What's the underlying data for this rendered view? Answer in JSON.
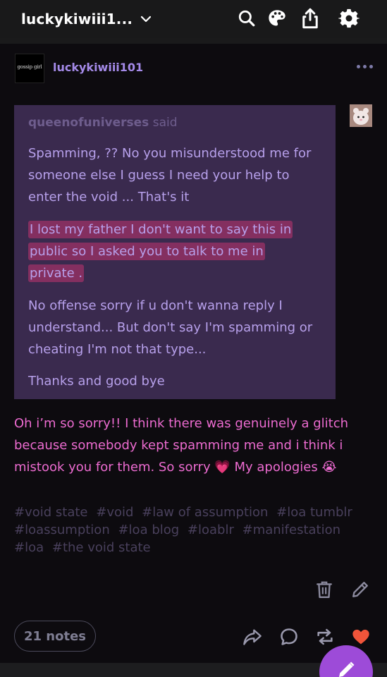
{
  "topbar": {
    "blog_name": "luckykiwiii1...",
    "icons": [
      "chevron-down-icon",
      "search-icon",
      "palette-icon",
      "share-icon",
      "gear-icon"
    ]
  },
  "post": {
    "avatar_text": "gossip girl",
    "username": "luckykiwiii101",
    "quote": {
      "author": "queenofuniverses",
      "said": "said",
      "paragraphs": [
        "Spamming, ?? No you misunderstood me for someone else I guess I need your help to enter the void ... That's it",
        "No offense sorry if u don't wanna reply I understand... But don't say I'm spamming or cheating I'm not that type...",
        "Thanks and good bye"
      ],
      "highlight_lines": [
        "I lost my father I don't want to say this in",
        "public so I asked you to talk to me in",
        "private ."
      ]
    },
    "reply": "Oh i’m so sorry!! I think there was genuinely a glitch because somebody kept spamming me and i think i mistook you for them. So sorry 💗 My apologies 😭",
    "tags": [
      "#void state",
      "#void",
      "#law of assumption",
      "#loa tumblr",
      "#loassumption",
      "#loa blog",
      "#loablr",
      "#manifestation",
      "#loa",
      "#the void state"
    ],
    "notes_label": "21 notes"
  },
  "colors": {
    "username": "#a48ae8",
    "quote_bg": "#3a2a4e",
    "quote_text": "#b7a0eb",
    "highlight": "#b6346c",
    "reply_text": "#ec6bd0",
    "tags": "#49405c",
    "like": "#f0553a",
    "fab": "#9d4bd8"
  }
}
